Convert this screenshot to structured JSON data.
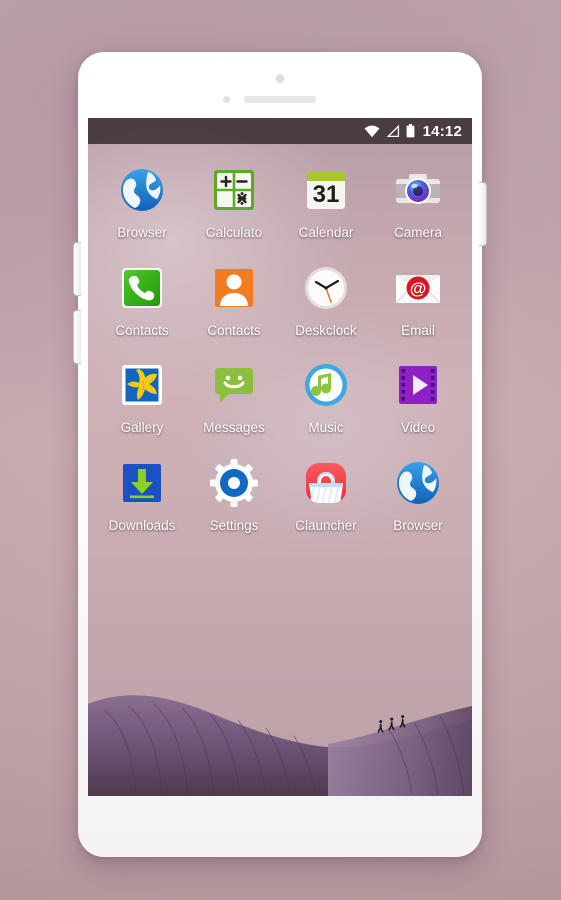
{
  "device": {
    "name": "android-phone-mockup",
    "hardware": {
      "front_camera": "front-camera",
      "earpiece": "earpiece-speaker",
      "proximity_sensor": "proximity-sensor",
      "volume_up": "volume-up-key",
      "volume_down": "volume-down-key",
      "power": "power-key"
    }
  },
  "statusbar": {
    "time": "14:12",
    "icons": [
      "wifi-icon",
      "signal-icon",
      "battery-icon"
    ]
  },
  "home": {
    "wallpaper": "purple-sand-dunes-with-walkers",
    "apps": [
      {
        "label": "Browser",
        "icon": "browser-globe-icon",
        "color": "#1a7fd4"
      },
      {
        "label": "Calculato",
        "icon": "calculator-icon",
        "color": "#4caf28"
      },
      {
        "label": "Calendar",
        "icon": "calendar-31-icon",
        "color": "#a8c32e"
      },
      {
        "label": "Camera",
        "icon": "camera-icon",
        "color": "#6a3fb5"
      },
      {
        "label": "Contacts",
        "icon": "phone-dialer-icon",
        "color": "#2fa319"
      },
      {
        "label": "Contacts",
        "icon": "contacts-person-icon",
        "color": "#f47a20"
      },
      {
        "label": "Deskclock",
        "icon": "analog-clock-icon",
        "color": "#f36c21"
      },
      {
        "label": "Email",
        "icon": "email-envelope-icon",
        "color": "#d81f26"
      },
      {
        "label": "Gallery",
        "icon": "gallery-flower-icon",
        "color": "#f6c21a"
      },
      {
        "label": "Messages",
        "icon": "messages-bubble-icon",
        "color": "#8bc34a"
      },
      {
        "label": "Music",
        "icon": "music-note-icon",
        "color": "#3aa6e0"
      },
      {
        "label": "Video",
        "icon": "video-film-icon",
        "color": "#8e24c8"
      },
      {
        "label": "Downloads",
        "icon": "download-arrow-icon",
        "color": "#1b4fc4"
      },
      {
        "label": "Settings",
        "icon": "settings-gear-icon",
        "color": "#1565c0"
      },
      {
        "label": "Clauncher",
        "icon": "clauncher-basket-icon",
        "color": "#f2464b"
      },
      {
        "label": "Browser",
        "icon": "browser-globe-icon",
        "color": "#1a7fd4"
      }
    ]
  },
  "colors": {
    "backdrop": "#c4a7ad",
    "statusbar": "#3a3032",
    "label_text": "#ffffff",
    "dune": "#6e5574"
  }
}
